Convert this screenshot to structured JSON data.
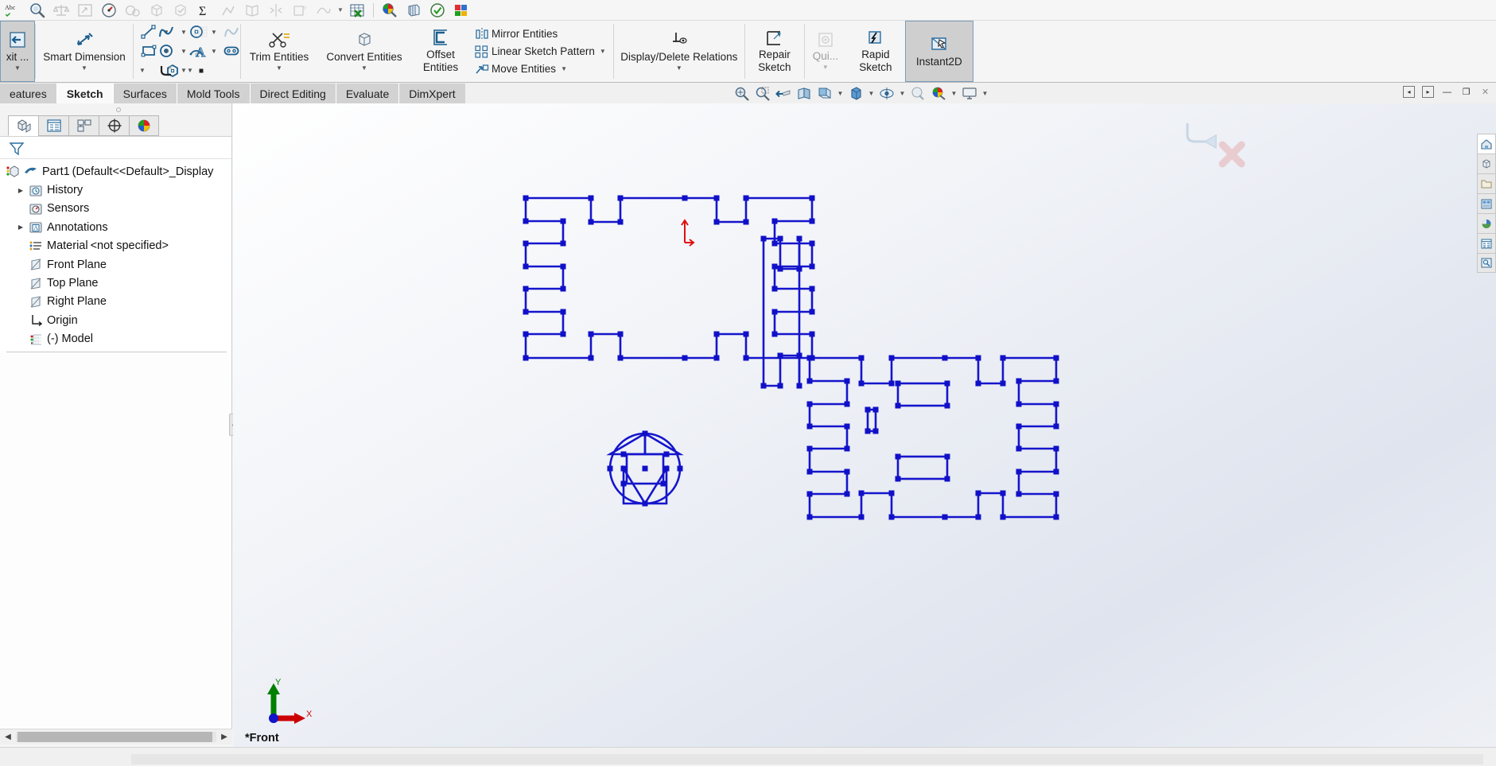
{
  "app": {
    "view_label": "*Front"
  },
  "quick_access": {
    "icons": [
      {
        "name": "spell-check-icon",
        "glyph": "Abc",
        "dim": false
      },
      {
        "name": "measure-icon",
        "glyph": "⌾",
        "dim": false
      },
      {
        "name": "mass-properties-icon",
        "glyph": "⚖",
        "dim": true
      },
      {
        "name": "section-properties-icon",
        "glyph": "↱",
        "dim": true
      },
      {
        "name": "sensor-icon",
        "glyph": "◔",
        "dim": false
      },
      {
        "name": "performance-evaluation-icon",
        "glyph": "◎",
        "dim": true
      },
      {
        "name": "geometry-analysis-icon",
        "glyph": "⬟",
        "dim": true
      },
      {
        "name": "check-entity-icon",
        "glyph": "⬡",
        "dim": true
      },
      {
        "name": "equations-icon",
        "glyph": "Σ",
        "dim": false
      },
      {
        "name": "import-diagnostics-icon",
        "glyph": "⬌",
        "dim": true
      },
      {
        "name": "compare-documents-icon",
        "glyph": "◧",
        "dim": true
      },
      {
        "name": "symmetry-check-icon",
        "glyph": "⇲",
        "dim": true
      },
      {
        "name": "thickness-analysis-icon",
        "glyph": "⧉",
        "dim": true
      },
      {
        "name": "curvature-icon",
        "glyph": "⌇",
        "dim": true
      },
      {
        "name": "design-table-icon",
        "glyph": "☷",
        "dim": false
      },
      {
        "name": "colormap-icon",
        "glyph": "◕",
        "dim": false
      },
      {
        "name": "zebra-stripes-icon",
        "glyph": "▒",
        "dim": false
      },
      {
        "name": "check-mark-icon",
        "glyph": "✔",
        "dim": false
      },
      {
        "name": "sustainability-icon",
        "glyph": "▣",
        "dim": false
      }
    ]
  },
  "ribbon": {
    "groups": [
      {
        "name": "exit-sketch-group",
        "items": [
          {
            "name": "exit-sketch-button",
            "label": "xit ...",
            "icon": "exit-sketch-icon",
            "selected": true,
            "caret": true
          }
        ]
      },
      {
        "name": "dimension-group",
        "items": [
          {
            "name": "smart-dimension-button",
            "label": "Smart Dimension",
            "icon": "smart-dimension-icon",
            "selected": false,
            "caret": true
          }
        ]
      },
      {
        "name": "sketch-entities-group",
        "small_icons": [
          {
            "name": "line-icon",
            "glyph": "line"
          },
          {
            "name": "circle-icon",
            "glyph": "circle"
          },
          {
            "name": "spline-icon",
            "glyph": "spline"
          },
          {
            "name": "grid-icon",
            "glyph": "grid"
          },
          {
            "name": "rectangle-icon",
            "glyph": "rect"
          },
          {
            "name": "arc-icon",
            "glyph": "arc"
          },
          {
            "name": "perimeter-circle-icon",
            "glyph": "circle2"
          },
          {
            "name": "text-icon",
            "glyph": "text-a"
          },
          {
            "name": "slot-icon",
            "glyph": "slot"
          },
          {
            "name": "polygon-icon",
            "glyph": "polygon"
          },
          {
            "name": "fillet-icon",
            "glyph": "fillet"
          },
          {
            "name": "point-icon",
            "glyph": "point"
          }
        ]
      },
      {
        "name": "trim-convert-group",
        "items": [
          {
            "name": "trim-entities-button",
            "label": "Trim Entities",
            "icon": "trim-entities-icon",
            "selected": false,
            "caret": true
          },
          {
            "name": "convert-entities-button",
            "label": "Convert Entities",
            "icon": "convert-entities-icon",
            "selected": false,
            "caret": true
          },
          {
            "name": "offset-entities-button",
            "label": "Offset Entities",
            "icon": "offset-entities-icon",
            "selected": false,
            "caret": false
          }
        ]
      },
      {
        "name": "pattern-group",
        "rows": [
          {
            "name": "mirror-entities-row",
            "label": "Mirror Entities",
            "icon": "mirror-entities-icon",
            "caret": false
          },
          {
            "name": "linear-sketch-pattern-row",
            "label": "Linear Sketch Pattern",
            "icon": "linear-sketch-pattern-icon",
            "caret": true
          },
          {
            "name": "move-entities-row",
            "label": "Move Entities",
            "icon": "move-entities-icon",
            "caret": true
          }
        ]
      },
      {
        "name": "relations-group",
        "items": [
          {
            "name": "display-delete-relations-button",
            "label": "Display/Delete Relations",
            "icon": "display-delete-relations-icon",
            "selected": false,
            "caret": true
          }
        ]
      },
      {
        "name": "tools-group",
        "items": [
          {
            "name": "repair-sketch-button",
            "label": "Repair Sketch",
            "icon": "repair-sketch-icon",
            "selected": false,
            "caret": false
          },
          {
            "name": "quick-snaps-button",
            "label": "Qui...",
            "icon": "quick-snaps-icon",
            "selected": false,
            "caret": true,
            "disabled": true
          },
          {
            "name": "rapid-sketch-button",
            "label": "Rapid Sketch",
            "icon": "rapid-sketch-icon",
            "selected": false,
            "caret": false
          },
          {
            "name": "instant2d-button",
            "label": "Instant2D",
            "icon": "instant2d-icon",
            "selected": true,
            "caret": false
          }
        ]
      }
    ]
  },
  "tabs": [
    {
      "name": "tab-features",
      "label": "eatures",
      "active": false
    },
    {
      "name": "tab-sketch",
      "label": "Sketch",
      "active": true
    },
    {
      "name": "tab-surfaces",
      "label": "Surfaces",
      "active": false
    },
    {
      "name": "tab-mold-tools",
      "label": "Mold Tools",
      "active": false
    },
    {
      "name": "tab-direct-editing",
      "label": "Direct Editing",
      "active": false
    },
    {
      "name": "tab-evaluate",
      "label": "Evaluate",
      "active": false
    },
    {
      "name": "tab-dimxpert",
      "label": "DimXpert",
      "active": false
    }
  ],
  "view_toolbar": {
    "icons": [
      {
        "name": "zoom-to-fit-icon",
        "caret": false
      },
      {
        "name": "zoom-to-area-icon",
        "caret": false
      },
      {
        "name": "previous-view-icon",
        "caret": false
      },
      {
        "name": "section-view-icon",
        "caret": false
      },
      {
        "name": "view-orientation-icon",
        "caret": true
      },
      {
        "name": "display-style-icon",
        "caret": true
      },
      {
        "name": "hide-show-items-icon",
        "caret": true
      },
      {
        "name": "edit-appearance-icon",
        "caret": false
      },
      {
        "name": "apply-scene-icon",
        "caret": true
      },
      {
        "name": "view-settings-icon",
        "caret": true
      }
    ]
  },
  "window_buttons": [
    {
      "name": "restore-left-button",
      "glyph": "◂"
    },
    {
      "name": "restore-right-button",
      "glyph": "▸"
    },
    {
      "name": "minimize-button",
      "glyph": "—"
    },
    {
      "name": "restore-button",
      "glyph": "❐"
    },
    {
      "name": "close-button",
      "glyph": "✕"
    }
  ],
  "feature_manager": {
    "tabs": [
      {
        "name": "tab-feature-manager-design-tree",
        "icon": "feature-tree-icon",
        "active": true
      },
      {
        "name": "tab-property-manager",
        "icon": "property-manager-icon",
        "active": false
      },
      {
        "name": "tab-configuration-manager",
        "icon": "configuration-manager-icon",
        "active": false
      },
      {
        "name": "tab-dimxpert-manager",
        "icon": "dimxpert-manager-icon",
        "active": false
      },
      {
        "name": "tab-display-manager",
        "icon": "display-manager-icon",
        "active": false
      }
    ],
    "filter_icon": "filter-icon",
    "tree": [
      {
        "name": "tree-item-part1",
        "label": "Part1",
        "sub": "(Default<<Default>_Display",
        "icon": "part-icon",
        "twisty": "none",
        "indent": 0
      },
      {
        "name": "tree-item-history",
        "label": "History",
        "sub": "",
        "icon": "history-icon",
        "twisty": "collapsed",
        "indent": 1
      },
      {
        "name": "tree-item-sensors",
        "label": "Sensors",
        "sub": "",
        "icon": "sensors-icon",
        "twisty": "none",
        "indent": 1
      },
      {
        "name": "tree-item-annotations",
        "label": "Annotations",
        "sub": "",
        "icon": "annotations-icon",
        "twisty": "collapsed",
        "indent": 1
      },
      {
        "name": "tree-item-material",
        "label": "Material",
        "sub": "<not specified>",
        "icon": "material-icon",
        "twisty": "none",
        "indent": 1
      },
      {
        "name": "tree-item-front-plane",
        "label": "Front Plane",
        "sub": "",
        "icon": "plane-icon",
        "twisty": "none",
        "indent": 1
      },
      {
        "name": "tree-item-top-plane",
        "label": "Top Plane",
        "sub": "",
        "icon": "plane-icon",
        "twisty": "none",
        "indent": 1
      },
      {
        "name": "tree-item-right-plane",
        "label": "Right Plane",
        "sub": "",
        "icon": "plane-icon",
        "twisty": "none",
        "indent": 1
      },
      {
        "name": "tree-item-origin",
        "label": "Origin",
        "sub": "",
        "icon": "origin-icon",
        "twisty": "none",
        "indent": 1
      },
      {
        "name": "tree-item-model",
        "label": "(-) Model",
        "sub": "",
        "icon": "sketch-icon",
        "twisty": "none",
        "indent": 1
      }
    ]
  },
  "right_dock": [
    {
      "name": "dock-item-home-icon"
    },
    {
      "name": "dock-item-design-library-icon"
    },
    {
      "name": "dock-item-file-explorer-icon"
    },
    {
      "name": "dock-item-view-palette-icon"
    },
    {
      "name": "dock-item-appearances-icon"
    },
    {
      "name": "dock-item-custom-properties-icon"
    },
    {
      "name": "dock-item-search-icon"
    }
  ],
  "triad": {
    "x_label": "X",
    "y_label": "Y",
    "x_color": "#cc0000",
    "y_color": "#007f00"
  },
  "sketch": {
    "line_color": "#1515cc",
    "point_color": "#1010c8",
    "origin_marker_color": "#e01010"
  }
}
